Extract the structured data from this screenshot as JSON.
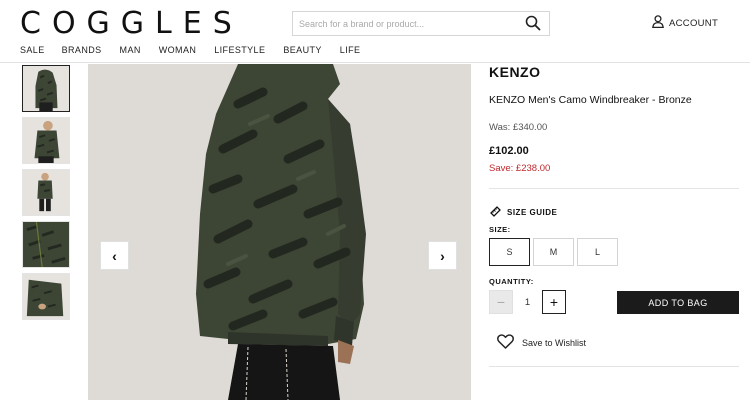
{
  "header": {
    "logo": "COGGLES",
    "search_placeholder": "Search for a brand or product...",
    "account_label": "ACCOUNT"
  },
  "nav": {
    "items": [
      "SALE",
      "BRANDS",
      "MAN",
      "WOMAN",
      "LIFESTYLE",
      "BEAUTY",
      "LIFE"
    ]
  },
  "gallery": {
    "thumbnail_count": 5,
    "active_thumbnail": 1,
    "prev_label": "‹",
    "next_label": "›"
  },
  "product": {
    "brand": "KENZO",
    "name": "KENZO Men's Camo Windbreaker - Bronze",
    "was_price": "Was: £340.00",
    "price": "£102.00",
    "save": "Save: £238.00",
    "size_guide_label": "SIZE GUIDE",
    "size_label": "SIZE:",
    "sizes": [
      "S",
      "M",
      "L"
    ],
    "selected_size": "S",
    "quantity_label": "QUANTITY:",
    "quantity": "1",
    "qty_minus": "−",
    "qty_plus": "+",
    "add_to_bag_label": "ADD TO BAG",
    "wishlist_label": "Save to Wishlist"
  },
  "colors": {
    "accent_sale": "#c0272d",
    "button_dark": "#1b1b1b",
    "jacket_green": "#3d4535"
  },
  "icons": {
    "search": "search-icon",
    "account": "user-icon",
    "size_guide": "ruler-tag-icon",
    "wishlist": "heart-icon"
  }
}
